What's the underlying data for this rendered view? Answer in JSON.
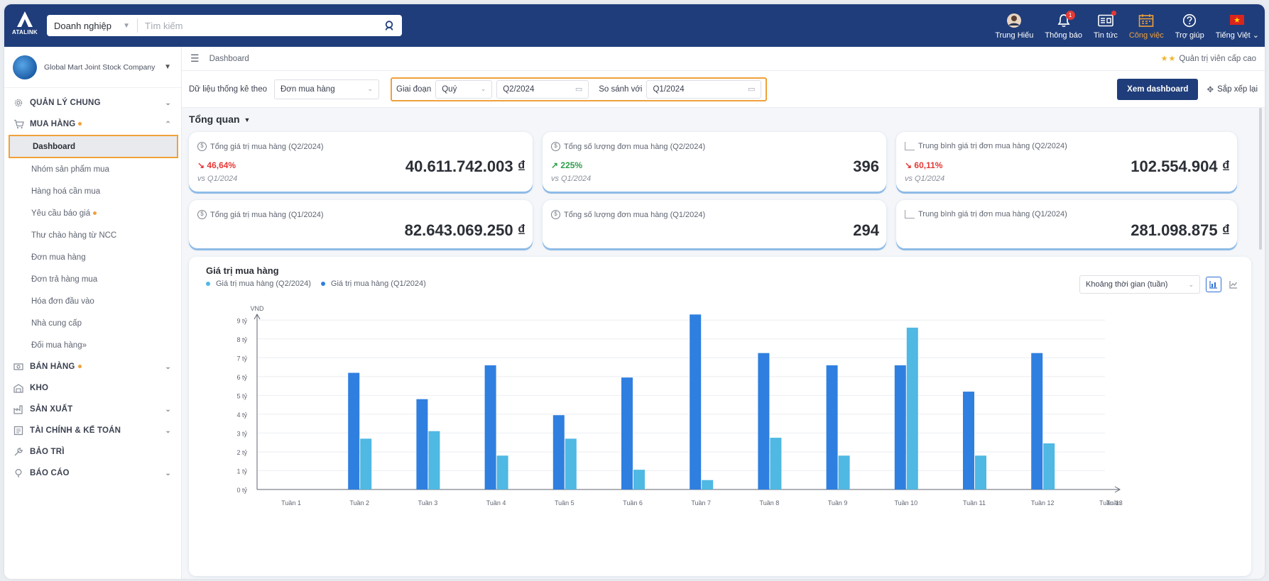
{
  "topbar": {
    "logo_text": "ATALINK",
    "search_scope": "Doanh nghiệp",
    "search_placeholder": "Tìm kiếm",
    "nav": [
      {
        "label": "Trung Hiếu",
        "icon": "avatar-icon"
      },
      {
        "label": "Thông báo",
        "icon": "bell-icon",
        "badge": "1"
      },
      {
        "label": "Tin tức",
        "icon": "news-icon"
      },
      {
        "label": "Công việc",
        "icon": "calendar-icon"
      },
      {
        "label": "Trợ giúp",
        "icon": "help-icon"
      },
      {
        "label": "Tiếng Việt",
        "icon": "vietnam-flag-icon"
      }
    ]
  },
  "sidebar": {
    "company_name": "Global Mart Joint Stock Company",
    "sections": [
      {
        "label": "QUẢN LÝ CHUNG",
        "icon": "gear-icon"
      },
      {
        "label": "MUA HÀNG",
        "icon": "cart-icon"
      },
      {
        "label": "BÁN HÀNG",
        "icon": "cash-icon"
      },
      {
        "label": "KHO",
        "icon": "warehouse-icon"
      },
      {
        "label": "SẢN XUẤT",
        "icon": "factory-icon"
      },
      {
        "label": "TÀI CHÍNH & KẾ TOÁN",
        "icon": "finance-icon"
      },
      {
        "label": "BẢO TRÌ",
        "icon": "wrench-icon"
      },
      {
        "label": "BÁO CÁO",
        "icon": "report-icon"
      }
    ],
    "purchase_items": [
      "Dashboard",
      "Nhóm sản phẩm mua",
      "Hàng hoá cần mua",
      "Yêu cầu báo giá",
      "Thư chào hàng từ NCC",
      "Đơn mua hàng",
      "Đơn trả hàng mua",
      "Hóa đơn đầu vào",
      "Nhà cung cấp",
      "Đối mua hàng"
    ]
  },
  "breadcrumb": {
    "label": "Dashboard",
    "role": "Quản trị viên cấp cao"
  },
  "filters": {
    "stats_by_label": "Dữ liệu thống kê theo",
    "stats_by_value": "Đơn mua hàng",
    "period_label": "Giai đoạn",
    "period_type": "Quý",
    "period_value": "Q2/2024",
    "compare_label": "So sánh với",
    "compare_value": "Q1/2024",
    "view_button": "Xem dashboard",
    "arrange_label": "Sắp xếp lại"
  },
  "overview": {
    "title": "Tổng quan",
    "cards": [
      {
        "title": "Tổng giá trị mua hàng (Q2/2024)",
        "value": "40.611.742.003 ₫",
        "change": "46,64%",
        "trend": "down",
        "vs": "vs Q1/2024"
      },
      {
        "title": "Tổng số lượng đơn mua hàng (Q2/2024)",
        "value": "396",
        "change": "225%",
        "trend": "up",
        "vs": "vs Q1/2024"
      },
      {
        "title": "Trung bình giá trị đơn mua hàng (Q2/2024)",
        "value": "102.554.904 ₫",
        "change": "60,11%",
        "trend": "down",
        "vs": "vs Q1/2024"
      },
      {
        "title": "Tổng giá trị mua hàng (Q1/2024)",
        "value": "82.643.069.250 ₫"
      },
      {
        "title": "Tổng số lượng đơn mua hàng (Q1/2024)",
        "value": "294"
      },
      {
        "title": "Trung bình giá trị đơn mua hàng (Q1/2024)",
        "value": "281.098.875 ₫"
      }
    ]
  },
  "chart_panel": {
    "title": "Giá trị mua hàng",
    "time_select": "Khoảng thời gian (tuần)"
  },
  "colors": {
    "brand": "#1f3d7a",
    "highlight": "#f0a13a",
    "series_q2": "#4fb8e3",
    "series_q1": "#2f7fe0"
  },
  "chart_data": {
    "type": "bar",
    "ylabel": "VND",
    "ylim": [
      0,
      9.5
    ],
    "yticks": [
      "0 tỷ",
      "1 tỷ",
      "2 tỷ",
      "3 tỷ",
      "4 tỷ",
      "5 tỷ",
      "6 tỷ",
      "7 tỷ",
      "8 tỷ",
      "9 tỷ"
    ],
    "categories": [
      "Tuần 1",
      "Tuần 2",
      "Tuần 3",
      "Tuần 4",
      "Tuần 5",
      "Tuần 6",
      "Tuần 7",
      "Tuần 8",
      "Tuần 9",
      "Tuần 10",
      "Tuần 11",
      "Tuần 12",
      "Tuần 13"
    ],
    "x_end_label": "Tuần",
    "series": [
      {
        "name": "Giá trị mua hàng (Q2/2024)",
        "values": [
          0,
          2.7,
          3.1,
          1.8,
          2.7,
          1.05,
          0.5,
          2.75,
          1.8,
          8.6,
          1.8,
          2.45,
          0
        ]
      },
      {
        "name": "Giá trị mua hàng (Q1/2024)",
        "values": [
          0,
          6.2,
          4.8,
          6.6,
          3.95,
          5.95,
          9.3,
          7.25,
          6.6,
          6.6,
          5.2,
          7.25,
          0
        ]
      }
    ],
    "grid": true,
    "legend_position": "top-left"
  }
}
